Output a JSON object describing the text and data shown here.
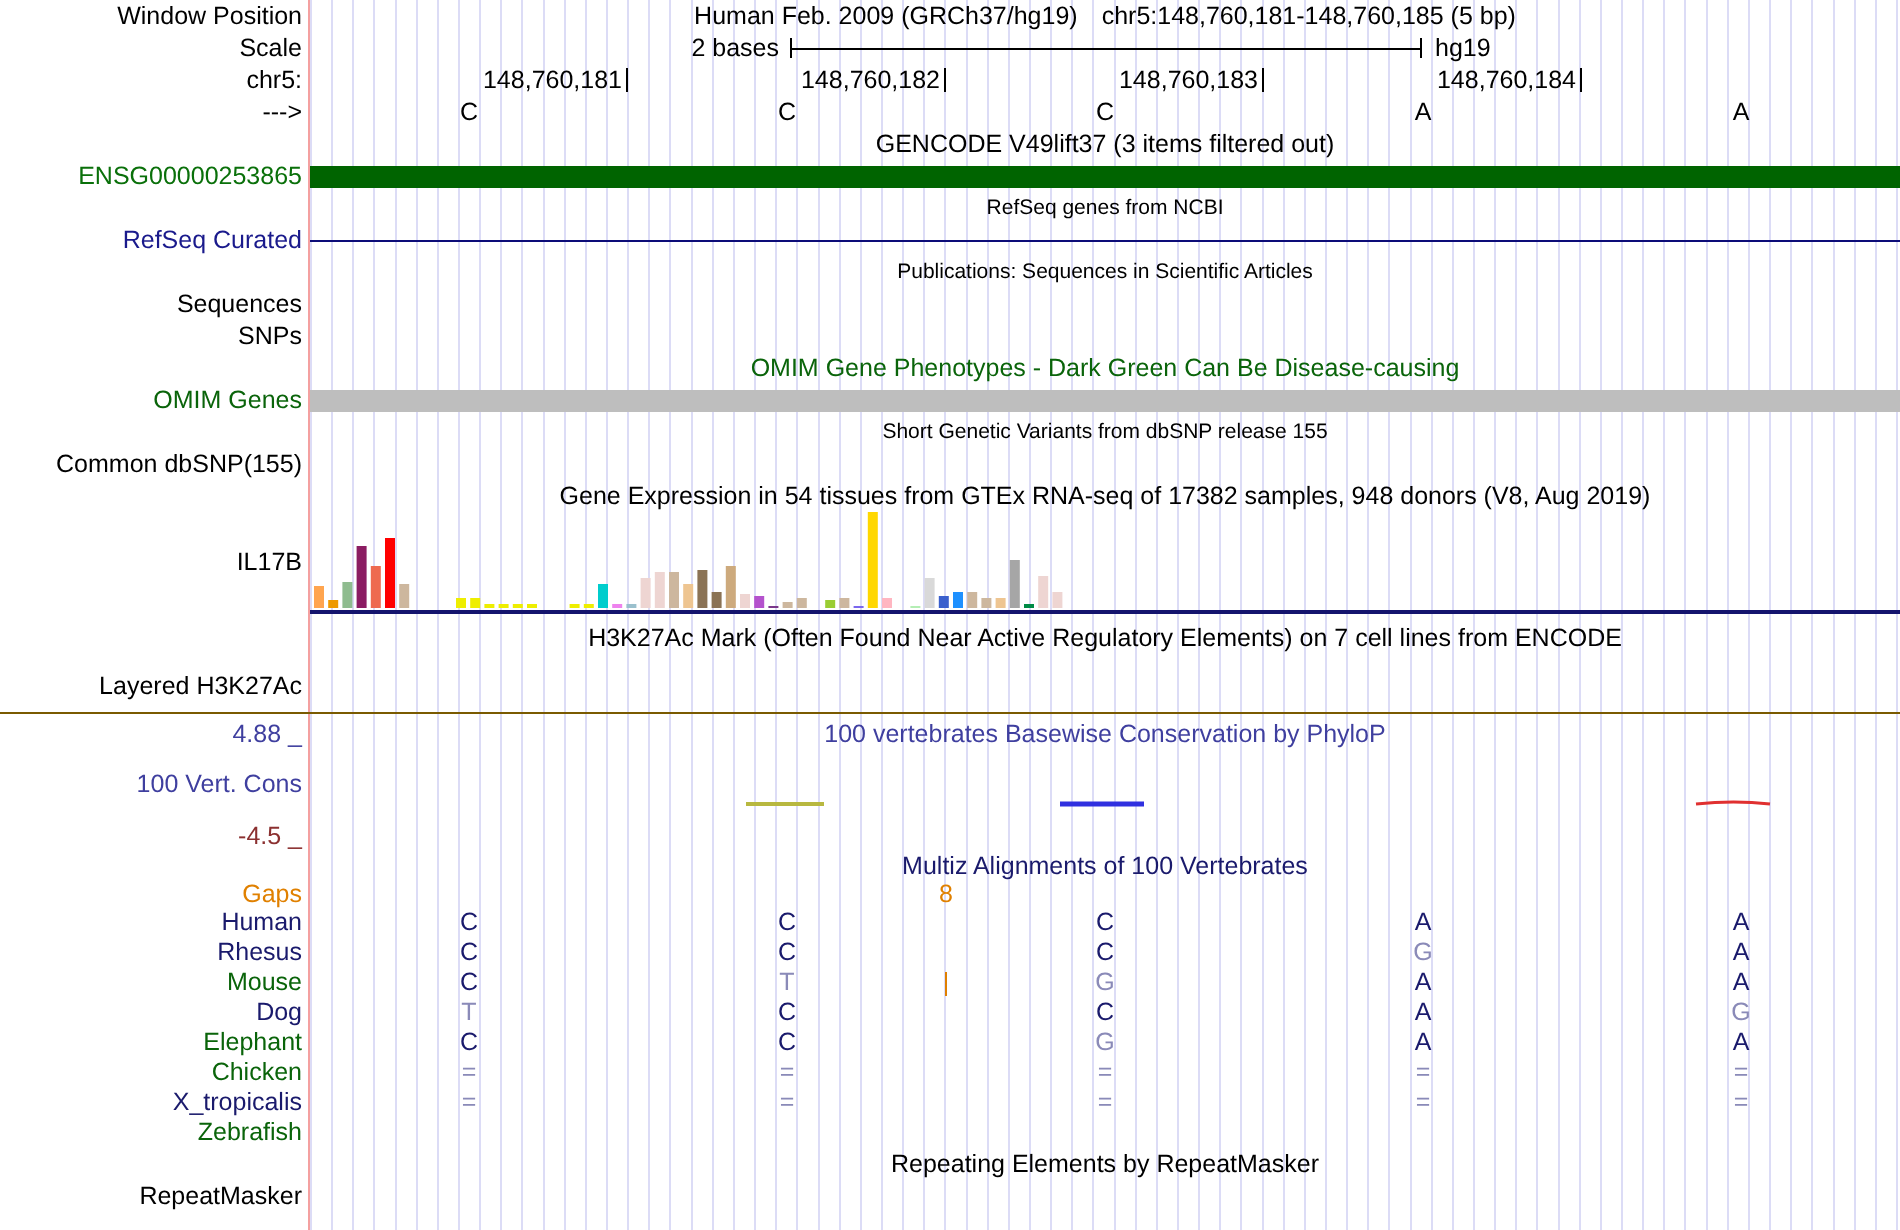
{
  "header": {
    "window_position": {
      "label": "Window Position",
      "assembly": "Human Feb. 2009 (GRCh37/hg19)",
      "range": "chr5:148,760,181-148,760,185 (5 bp)"
    },
    "scale": {
      "label": "Scale",
      "span": "2 bases",
      "assembly": "hg19"
    },
    "ruler": {
      "label": "chr5:",
      "positions": [
        "148,760,181",
        "148,760,182",
        "148,760,183",
        "148,760,184"
      ]
    },
    "strand": {
      "label": "--->",
      "bases": [
        "C",
        "C",
        "C",
        "A",
        "A"
      ]
    }
  },
  "tracks": [
    {
      "kind": "gene",
      "title": "GENCODE V49lift37 (3 items filtered out)",
      "rows": [
        {
          "label": "ENSG00000253865",
          "color": "#0a700a"
        }
      ]
    },
    {
      "kind": "refseq",
      "title": "RefSeq genes from NCBI",
      "rows": [
        {
          "label": "RefSeq Curated",
          "color": "#1a1a8c"
        }
      ]
    },
    {
      "kind": "publication",
      "title": "Publications: Sequences in Scientific Articles",
      "rows": [
        {
          "label": "Sequences",
          "color": "#000000"
        },
        {
          "label": "SNPs",
          "color": "#000000"
        }
      ]
    },
    {
      "kind": "phenotype",
      "title": "OMIM Gene Phenotypes - Dark Green Can Be Disease-causing",
      "rows": [
        {
          "label": "OMIM Genes",
          "color": "#0a640a"
        }
      ]
    },
    {
      "kind": "variants",
      "title": "Short Genetic Variants from dbSNP release 155",
      "rows": [
        {
          "label": "Common dbSNP(155)",
          "color": "#000000"
        }
      ]
    },
    {
      "kind": "expression",
      "title": "Gene Expression in 54 tissues from GTEx RNA-seq of 17382 samples, 948 donors (V8, Aug 2019)",
      "rows": [
        {
          "label": "IL17B",
          "color": "#000000"
        }
      ]
    },
    {
      "kind": "layered",
      "title": "H3K27Ac Mark (Often Found Near Active Regulatory Elements) on 7 cell lines from ENCODE",
      "rows": [
        {
          "label": "Layered H3K27Ac",
          "color": "#000000"
        }
      ]
    },
    {
      "kind": "conservation",
      "title": "100 vertebrates Basewise Conservation by PhyloP",
      "max": {
        "text": "4.88 _",
        "color": "#3f3f9f"
      },
      "rows": [
        {
          "label": "100 Vert. Cons",
          "color": "#3f3f9f"
        }
      ],
      "min": {
        "text": "-4.5 _",
        "color": "#8b3030"
      }
    },
    {
      "kind": "multiz",
      "title": "Multiz Alignments of 100 Vertebrates",
      "gaps": {
        "label": "Gaps",
        "color": "#e08000",
        "count": "8"
      },
      "species": [
        {
          "name": "Human",
          "color": "#1a1a6c",
          "bases": [
            {
              "base": "C",
              "match": true,
              "insert": false
            },
            {
              "base": "C",
              "match": true,
              "insert": false
            },
            {
              "base": "C",
              "match": true,
              "insert": false
            },
            {
              "base": "A",
              "match": true,
              "insert": false
            },
            {
              "base": "A",
              "match": true,
              "insert": false
            }
          ]
        },
        {
          "name": "Rhesus",
          "color": "#1a1a6c",
          "bases": [
            {
              "base": "C",
              "match": true,
              "insert": false
            },
            {
              "base": "C",
              "match": true,
              "insert": false
            },
            {
              "base": "C",
              "match": true,
              "insert": false
            },
            {
              "base": "G",
              "match": false,
              "insert": false
            },
            {
              "base": "A",
              "match": true,
              "insert": false
            }
          ]
        },
        {
          "name": "Mouse",
          "color": "#0a640a",
          "bases": [
            {
              "base": "C",
              "match": true,
              "insert": false
            },
            {
              "base": "T",
              "match": false,
              "insert": true
            },
            {
              "base": "G",
              "match": false,
              "insert": false
            },
            {
              "base": "A",
              "match": true,
              "insert": false
            },
            {
              "base": "A",
              "match": true,
              "insert": false
            }
          ]
        },
        {
          "name": "Dog",
          "color": "#1a1a6c",
          "bases": [
            {
              "base": "T",
              "match": false,
              "insert": false
            },
            {
              "base": "C",
              "match": true,
              "insert": false
            },
            {
              "base": "C",
              "match": true,
              "insert": false
            },
            {
              "base": "A",
              "match": true,
              "insert": false
            },
            {
              "base": "G",
              "match": false,
              "insert": false
            }
          ]
        },
        {
          "name": "Elephant",
          "color": "#0a640a",
          "bases": [
            {
              "base": "C",
              "match": true,
              "insert": false
            },
            {
              "base": "C",
              "match": true,
              "insert": false
            },
            {
              "base": "G",
              "match": false,
              "insert": false
            },
            {
              "base": "A",
              "match": true,
              "insert": false
            },
            {
              "base": "A",
              "match": true,
              "insert": false
            }
          ]
        },
        {
          "name": "Chicken",
          "color": "#0a640a",
          "bases": [
            {
              "base": "=",
              "match": false,
              "insert": false
            },
            {
              "base": "=",
              "match": false,
              "insert": false
            },
            {
              "base": "=",
              "match": false,
              "insert": false
            },
            {
              "base": "=",
              "match": false,
              "insert": false
            },
            {
              "base": "=",
              "match": false,
              "insert": false
            }
          ]
        },
        {
          "name": "X_tropicalis",
          "color": "#1a1a6c",
          "bases": [
            {
              "base": "=",
              "match": false,
              "insert": false
            },
            {
              "base": "=",
              "match": false,
              "insert": false
            },
            {
              "base": "=",
              "match": false,
              "insert": false
            },
            {
              "base": "=",
              "match": false,
              "insert": false
            },
            {
              "base": "=",
              "match": false,
              "insert": false
            }
          ]
        },
        {
          "name": "Zebrafish",
          "color": "#0a640a"
        }
      ]
    },
    {
      "kind": "repeats",
      "title": "Repeating Elements by RepeatMasker",
      "rows": [
        {
          "label": "RepeatMasker",
          "color": "#000000"
        }
      ]
    }
  ]
}
